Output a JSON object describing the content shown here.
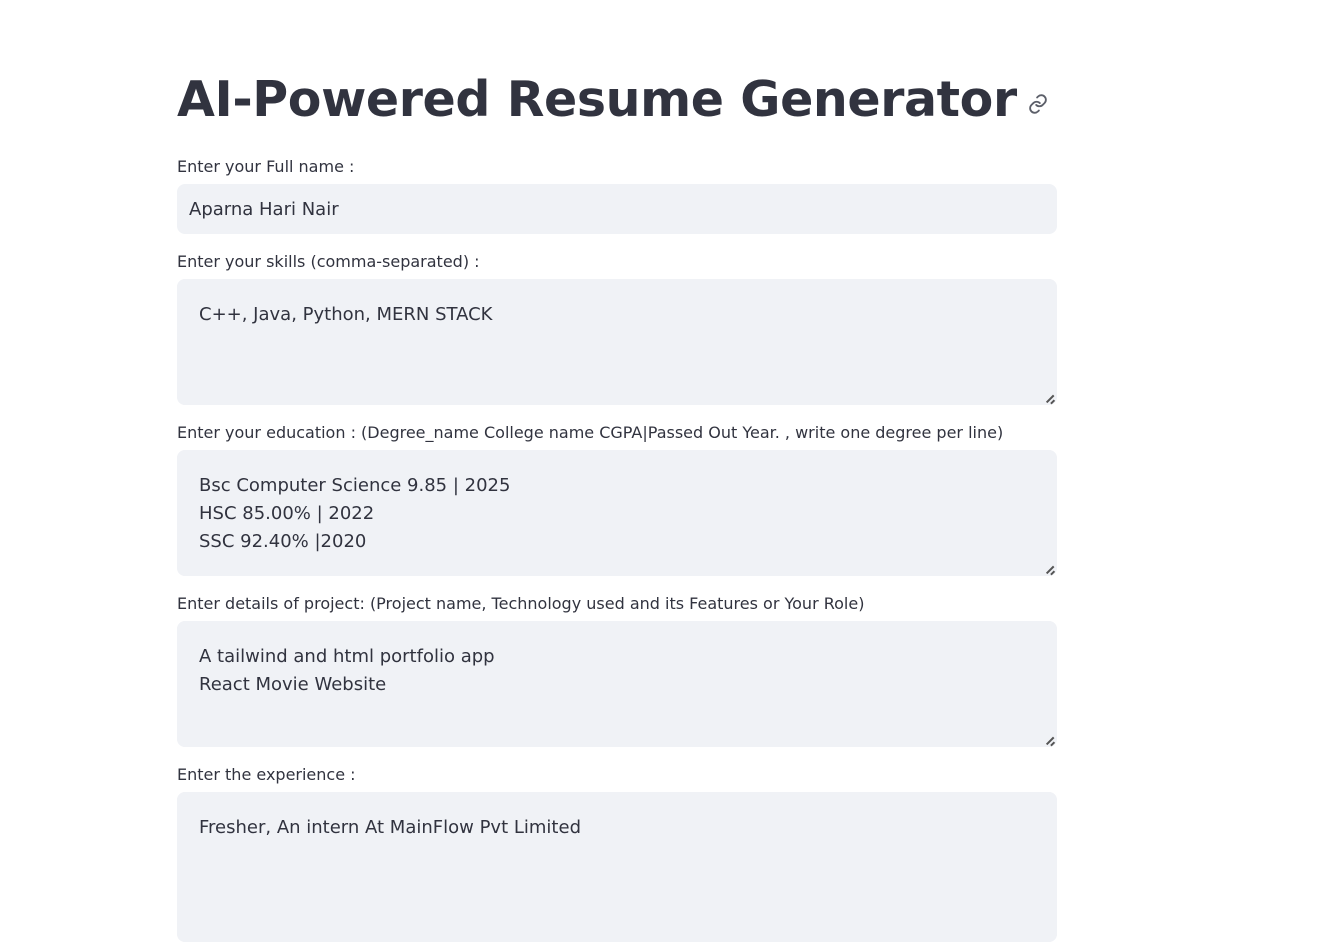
{
  "page": {
    "title": "AI-Powered Resume Generator",
    "link_icon": "link-icon"
  },
  "fields": {
    "full_name": {
      "label": "Enter your Full name :",
      "value": "Aparna Hari Nair"
    },
    "skills": {
      "label": "Enter your skills (comma-separated) :",
      "value": "C++, Java, Python, MERN STACK"
    },
    "education": {
      "label": "Enter your education : (Degree_name College name CGPA|Passed Out Year. , write one degree per line)",
      "value": "Bsc Computer Science 9.85 | 2025\nHSC 85.00% | 2022\nSSC 92.40% |2020"
    },
    "project": {
      "label": "Enter details of project: (Project name, Technology used and its Features or Your Role)",
      "value": "A tailwind and html portfolio app\nReact Movie Website"
    },
    "experience": {
      "label": "Enter the experience :",
      "value": "Fresher, An intern At MainFlow Pvt Limited"
    }
  },
  "colors": {
    "text": "#31333f",
    "input_background": "#f0f2f6",
    "page_background": "#ffffff"
  }
}
